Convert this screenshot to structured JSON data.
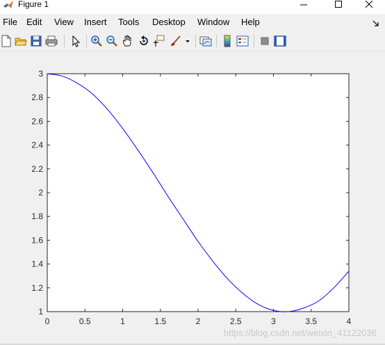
{
  "window": {
    "title": "Figure 1",
    "app_icon": "matlab-icon",
    "controls": [
      "minimize-icon",
      "maximize-icon",
      "close-icon"
    ]
  },
  "menu": {
    "items": [
      "File",
      "Edit",
      "View",
      "Insert",
      "Tools",
      "Desktop",
      "Window",
      "Help"
    ],
    "dock_icon": "dock-arrow-icon"
  },
  "toolbar": {
    "icons": [
      "new-figure-icon",
      "open-file-icon",
      "save-icon",
      "print-icon",
      "pointer-icon",
      "zoom-in-icon",
      "zoom-out-icon",
      "pan-icon",
      "rotate-3d-icon",
      "data-cursor-icon",
      "brush-icon",
      "link-plot-icon",
      "colorbar-icon",
      "legend-icon",
      "hide-plot-tools-icon",
      "show-plot-tools-icon"
    ]
  },
  "chart_data": {
    "type": "line",
    "title": "",
    "xlabel": "",
    "ylabel": "",
    "xlim": [
      0,
      4
    ],
    "ylim": [
      1,
      3
    ],
    "xticks": [
      "0",
      "0.5",
      "1",
      "1.5",
      "2",
      "2.5",
      "3",
      "3.5",
      "4"
    ],
    "yticks": [
      "1",
      "1.2",
      "1.4",
      "1.6",
      "1.8",
      "2",
      "2.2",
      "2.4",
      "2.6",
      "2.8",
      "3"
    ],
    "grid": false,
    "series": [
      {
        "color": "#0000ff",
        "x": [
          0,
          0.2,
          0.4,
          0.6,
          0.8,
          1.0,
          1.2,
          1.4,
          1.6,
          1.8,
          2.0,
          2.2,
          2.4,
          2.6,
          2.8,
          3.0,
          3.2,
          3.4,
          3.6,
          3.8,
          4.0
        ],
        "y": [
          3.0,
          2.98,
          2.92,
          2.83,
          2.7,
          2.54,
          2.36,
          2.17,
          1.97,
          1.78,
          1.59,
          1.42,
          1.27,
          1.15,
          1.06,
          1.01,
          1.0,
          1.03,
          1.09,
          1.2,
          1.34
        ]
      }
    ]
  },
  "watermark": "https://blog.csdn.net/weixin_41122036"
}
